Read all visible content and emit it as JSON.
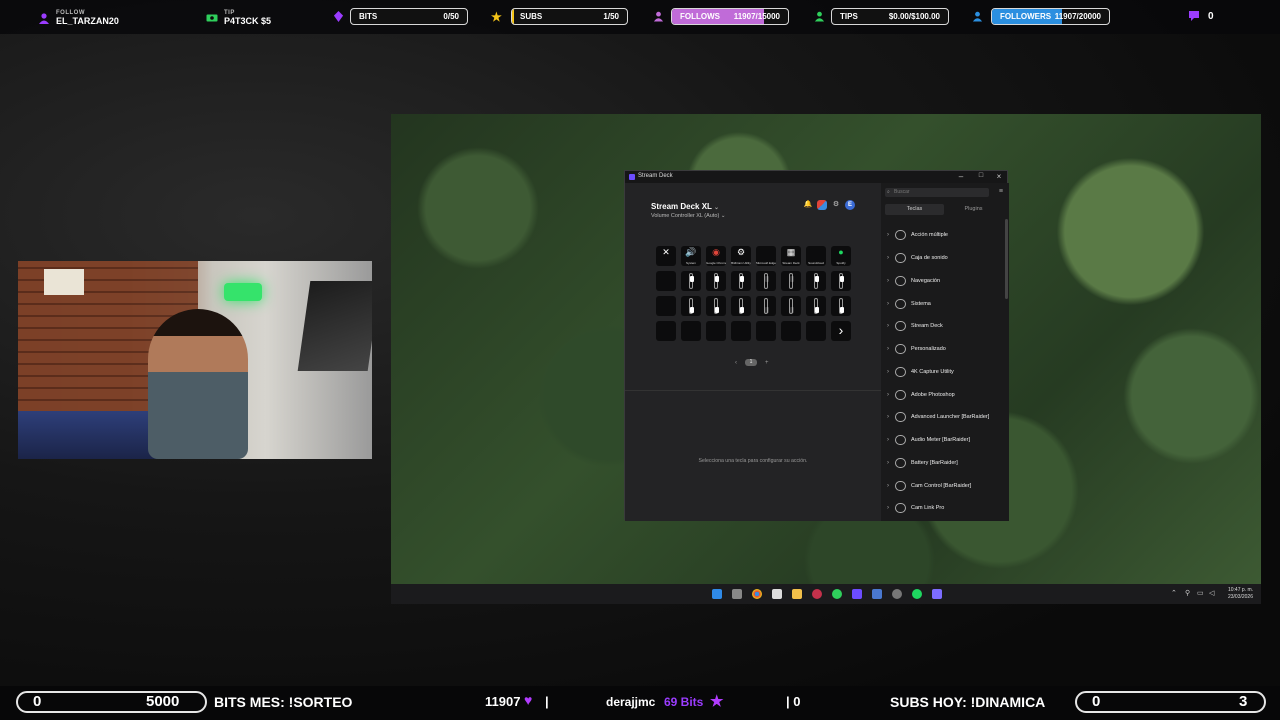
{
  "topbar": {
    "follow": {
      "label": "FOLLOW",
      "name": "EL_TARZAN20"
    },
    "tip": {
      "label": "TIP",
      "name": "P4T3CK $5"
    },
    "bits": {
      "label": "BITS",
      "value": "0/50",
      "progress": 0.0
    },
    "subs": {
      "label": "SUBS",
      "value": "1/50",
      "progress": 0.02
    },
    "follows": {
      "label": "FOLLOWS",
      "value": "11907/15000",
      "progress": 0.79
    },
    "tips": {
      "label": "TIPS",
      "value": "$0.00/$100.00",
      "progress": 0.0
    },
    "followers": {
      "label": "FOLLOWERS",
      "value": "11907/20000",
      "progress": 0.6
    },
    "chat_count": "0",
    "colors": {
      "purple": "#9b3cff",
      "pink": "#c06bd8",
      "blue": "#2b8fe0",
      "green": "#2fcf5c",
      "gold": "#f5c518"
    }
  },
  "stream_deck": {
    "window_title": "Stream Deck",
    "device_name": "Stream Deck XL",
    "profile_name": "Volume Controller XL (Auto)",
    "keys_row1": [
      {
        "glyph": "✕",
        "caption": ""
      },
      {
        "glyph": "🔊",
        "caption": "System"
      },
      {
        "glyph": "◉",
        "caption": "Google Chrome"
      },
      {
        "glyph": "⚙",
        "caption": "Bit4Cam Utility"
      },
      {
        "glyph": "",
        "caption": "Microsoft Edge"
      },
      {
        "glyph": "▦",
        "caption": "Stream Deck"
      },
      {
        "glyph": "",
        "caption": "Soundcloud"
      },
      {
        "glyph": "●",
        "caption": "Spotify"
      }
    ],
    "page_current": "1",
    "page_prev": "‹",
    "page_next": "+",
    "hint": "Selecciona una tecla para configurar su acción.",
    "search_placeholder": "Buscar",
    "tabs": [
      "Teclas",
      "Plugins"
    ],
    "categories": [
      {
        "label": "Acción múltiple",
        "icon": "multi-action-icon"
      },
      {
        "label": "Caja de sonido",
        "icon": "soundboard-icon"
      },
      {
        "label": "Navegación",
        "icon": "navigation-icon"
      },
      {
        "label": "Sistema",
        "icon": "system-icon"
      },
      {
        "label": "Stream Deck",
        "icon": "stream-deck-icon"
      },
      {
        "label": "Personalizado",
        "icon": "custom-icon"
      },
      {
        "label": "4K Capture Utility",
        "icon": "capture-icon"
      },
      {
        "label": "Adobe Photoshop",
        "icon": "photoshop-icon"
      },
      {
        "label": "Advanced Launcher [BarRaider]",
        "icon": "barraider-icon"
      },
      {
        "label": "Audio Meter [BarRaider]",
        "icon": "barraider-icon"
      },
      {
        "label": "Battery [BarRaider]",
        "icon": "barraider-icon"
      },
      {
        "label": "Cam Control [BarRaider]",
        "icon": "barraider-icon"
      },
      {
        "label": "Cam Link Pro",
        "icon": "camlink-icon"
      }
    ]
  },
  "taskbar": {
    "time": "10:47 p. m.",
    "date": "23/03/2026"
  },
  "bottombar": {
    "bits_min": "0",
    "bits_max": "5000",
    "bits_text": "BITS MES: !SORTEO",
    "followers_count": "11907",
    "sep1": "|",
    "last_bits_user": "derajjmc",
    "last_bits_amount": "69 Bits",
    "sep2": "| 0",
    "subs_text": "SUBS HOY: !DINAMICA",
    "subs_min": "0",
    "subs_max": "3"
  }
}
